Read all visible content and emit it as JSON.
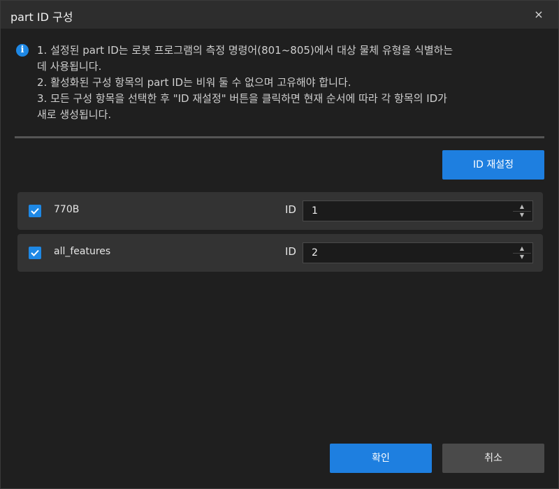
{
  "window": {
    "title": "part ID 구성",
    "close_glyph": "×"
  },
  "info": {
    "icon": "info-icon",
    "lines": [
      "1. 설정된 part ID는 로봇 프로그램의 측정 명령어(801~805)에서 대상 물체 유형을 식별하는",
      "데 사용됩니다.",
      "2. 활성화된 구성 항목의 part ID는 비워 둘 수 없으며 고유해야 합니다.",
      "3. 모든 구성 항목을 선택한 후 \"ID 재설정\" 버튼을 클릭하면 현재 순서에 따라 각 항목의 ID가",
      "새로 생성됩니다."
    ]
  },
  "toolbar": {
    "reset_label": "ID 재설정"
  },
  "items": [
    {
      "name": "770B",
      "checked": true,
      "id_label": "ID",
      "id_value": "1"
    },
    {
      "name": "all_features",
      "checked": true,
      "id_label": "ID",
      "id_value": "2"
    }
  ],
  "footer": {
    "ok_label": "확인",
    "cancel_label": "취소"
  },
  "colors": {
    "accent": "#1e7fe0",
    "background": "#1f1f1f",
    "row_background": "#333333"
  }
}
